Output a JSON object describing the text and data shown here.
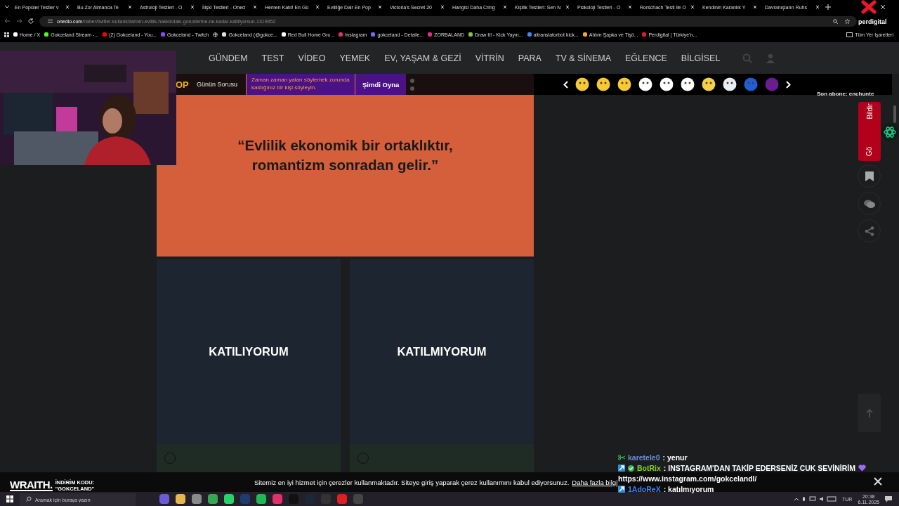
{
  "browser": {
    "tabs": [
      {
        "title": "En Popüler Testler v"
      },
      {
        "title": "Bu Zor Almanca Te"
      },
      {
        "title": "Astroloji Testleri - O"
      },
      {
        "title": "İlişki Testleri - Oned"
      },
      {
        "title": "Hemen Katıl! En Gü"
      },
      {
        "title": "Evliliğe Dair En Pop"
      },
      {
        "title": "Victoria's Secret 20"
      },
      {
        "title": "Hangisi Daha Cring"
      },
      {
        "title": "Kişilik Testleri: Sen N"
      },
      {
        "title": "Psikoloji Testleri - O"
      },
      {
        "title": "Rorschach Testi ile O"
      },
      {
        "title": "Kendinin Karanlık Y"
      },
      {
        "title": "Davranışların Ruhs"
      }
    ],
    "url": {
      "domain": "onedio.com",
      "path": "/haber/twitter-kullanicilarinin-evlilik-hakkindaki-goruslerine-ne-kadar-katiliyorsun-1319952"
    },
    "overlay_logo": "perdigital",
    "bookmarks": [
      {
        "label": "Home / X",
        "color": "#ffffff"
      },
      {
        "label": "Gokceland Stream -...",
        "color": "#53fc18"
      },
      {
        "label": "(2) Gokceland - You...",
        "color": "#ff0000"
      },
      {
        "label": "Gokceland - Twitch",
        "color": "#9146ff"
      },
      {
        "label": "Gokceland (@gokce...",
        "color": "#e0e0e0"
      },
      {
        "label": "Red Bull Home Gro...",
        "color": "#ffffff"
      },
      {
        "label": "Instagram",
        "color": "#e1306c"
      },
      {
        "label": "gokceland - Detaile...",
        "color": "#7b68ee"
      },
      {
        "label": "ZORBALAND",
        "color": "#d63384"
      },
      {
        "label": "Draw It! - Kick Yayın...",
        "color": "#8bc34a"
      },
      {
        "label": "aitranslatorbot kick...",
        "color": "#4285f4"
      },
      {
        "label": "Atılım Şapka ve Tişö...",
        "color": "#f5a623"
      },
      {
        "label": "Perdigital | Türkiye'n...",
        "color": "#e8192c"
      }
    ],
    "all_bookmarks": "Tüm Yer İşaretleri"
  },
  "site": {
    "nav": [
      "GÜNDEM",
      "TEST",
      "VİDEO",
      "YEMEK",
      "EV, YAŞAM & GEZİ",
      "VİTRİN",
      "PARA",
      "TV & SİNEMA",
      "EĞLENCE",
      "BİLGİSEL"
    ],
    "question_bar": {
      "logo": "OP",
      "label": "Günün Sorusu",
      "question": "Zaman zaman yalan söylemek zorunda kaldığınız bir kişi söyleyin.",
      "play": "Şimdi Oyna"
    },
    "quote": "“Evlilik ekonomik bir ortaklıktır, romantizm sonradan gelir.”",
    "options": [
      {
        "label": "KATILIYORUM",
        "selected": false
      },
      {
        "label": "KATILMIYORUM",
        "selected": false
      }
    ],
    "feedback": [
      "Gö",
      "Bildir"
    ],
    "cookie": {
      "text": "Sitemiz en iyi hizmet için çerezler kullanmaktadır. Siteye giriş yaparak çerez kullanımını kabul ediyorsunuz.",
      "link": "Daha fazla bilgi"
    }
  },
  "stream": {
    "last_sub": "Son abone: enchunte",
    "sponsor": {
      "brand": "WRAITH.",
      "line1": "İNDİRİM KODU:",
      "line2": "\"GOKCELAND\""
    },
    "chat": [
      {
        "user": "karetele0",
        "color": "#6b8fd6",
        "text": ": yenur"
      },
      {
        "user": "BotRix",
        "color": "#7ed321",
        "text": ": INSTAGRAM'DAN TAKİP EDERSENİZ CUK SEVİNİRİM",
        "link": "https://www.instagram.com/gokcelandl/"
      },
      {
        "user": "1AdoReX",
        "color": "#3b82f6",
        "text": ": katılmıyorum"
      }
    ]
  },
  "taskbar": {
    "search_placeholder": "Aramak için buraya yazın",
    "language": "TUR",
    "time": "20:38",
    "date": "6.11.2025"
  }
}
